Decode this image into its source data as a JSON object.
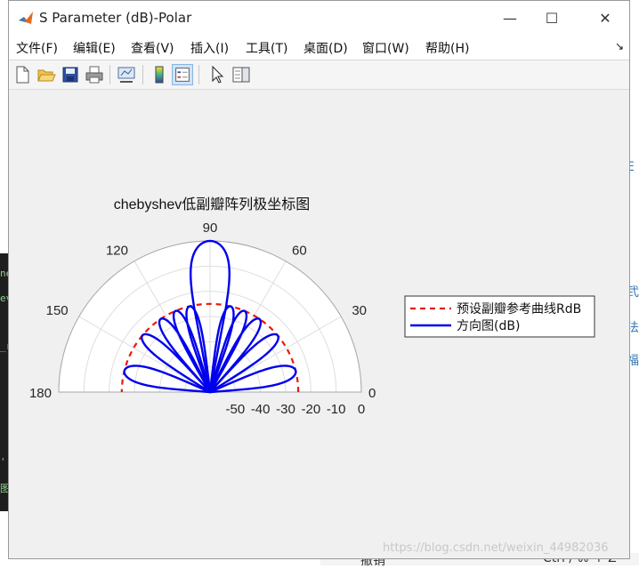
{
  "window": {
    "title": "S Parameter (dB)-Polar",
    "controls": {
      "minimize": "—",
      "maximize": "☐",
      "close": "✕"
    }
  },
  "menu": {
    "items": [
      "文件(F)",
      "编辑(E)",
      "查看(V)",
      "插入(I)",
      "工具(T)",
      "桌面(D)",
      "窗口(W)",
      "帮助(H)"
    ],
    "overflow": "↘"
  },
  "toolbar": {
    "buttons": [
      "new-figure-icon",
      "open-icon",
      "save-icon",
      "print-icon",
      "link-plot-icon",
      "colorbar-icon",
      "legend-icon",
      "pointer-icon",
      "property-editor-icon"
    ],
    "active": "legend-icon"
  },
  "chart_data": {
    "type": "polar",
    "title": "chebyshev低副瓣阵列极坐标图",
    "theta_range_deg": [
      0,
      180
    ],
    "theta_ticks": [
      "0",
      "30",
      "60",
      "90",
      "120",
      "150",
      "180"
    ],
    "r_ticks": [
      "-50",
      "-40",
      "-30",
      "-20",
      "-10",
      "0"
    ],
    "r_range_db": [
      -60,
      0
    ],
    "grid": true,
    "legend_position": "right",
    "series": [
      {
        "name": "预设副瓣参考曲线RdB",
        "style": "dashed",
        "color": "#e8190e",
        "theta_range_deg": [
          0,
          180
        ],
        "r_db": -25
      },
      {
        "name": "方向图(dB)",
        "style": "solid",
        "color": "#0000ee",
        "lobes": [
          {
            "center_deg": 90,
            "width_deg": 11,
            "peak_db": 0
          },
          {
            "center_deg": 76.5,
            "width_deg": 7,
            "peak_db": -25
          },
          {
            "center_deg": 67,
            "width_deg": 7,
            "peak_db": -25
          },
          {
            "center_deg": 56,
            "width_deg": 7.5,
            "peak_db": -25
          },
          {
            "center_deg": 40,
            "width_deg": 8,
            "peak_db": -25
          },
          {
            "center_deg": 14,
            "width_deg": 10,
            "peak_db": -25
          },
          {
            "center_deg": 103.5,
            "width_deg": 7,
            "peak_db": -25
          },
          {
            "center_deg": 113,
            "width_deg": 7,
            "peak_db": -25
          },
          {
            "center_deg": 124,
            "width_deg": 7.5,
            "peak_db": -25
          },
          {
            "center_deg": 140,
            "width_deg": 8,
            "peak_db": -25
          },
          {
            "center_deg": 166,
            "width_deg": 10,
            "peak_db": -25
          }
        ]
      }
    ]
  },
  "watermark": "https://blog.csdn.net/weixin_44982036",
  "background": {
    "left_fragments": [
      "ne",
      "ev",
      "_r",
      "'",
      "图"
    ],
    "right_fragments": [
      "E",
      "i",
      "弐",
      "法",
      "福"
    ],
    "bottom_fragments": [
      "撤销",
      "Ctrl / ⌘ + Z"
    ]
  }
}
